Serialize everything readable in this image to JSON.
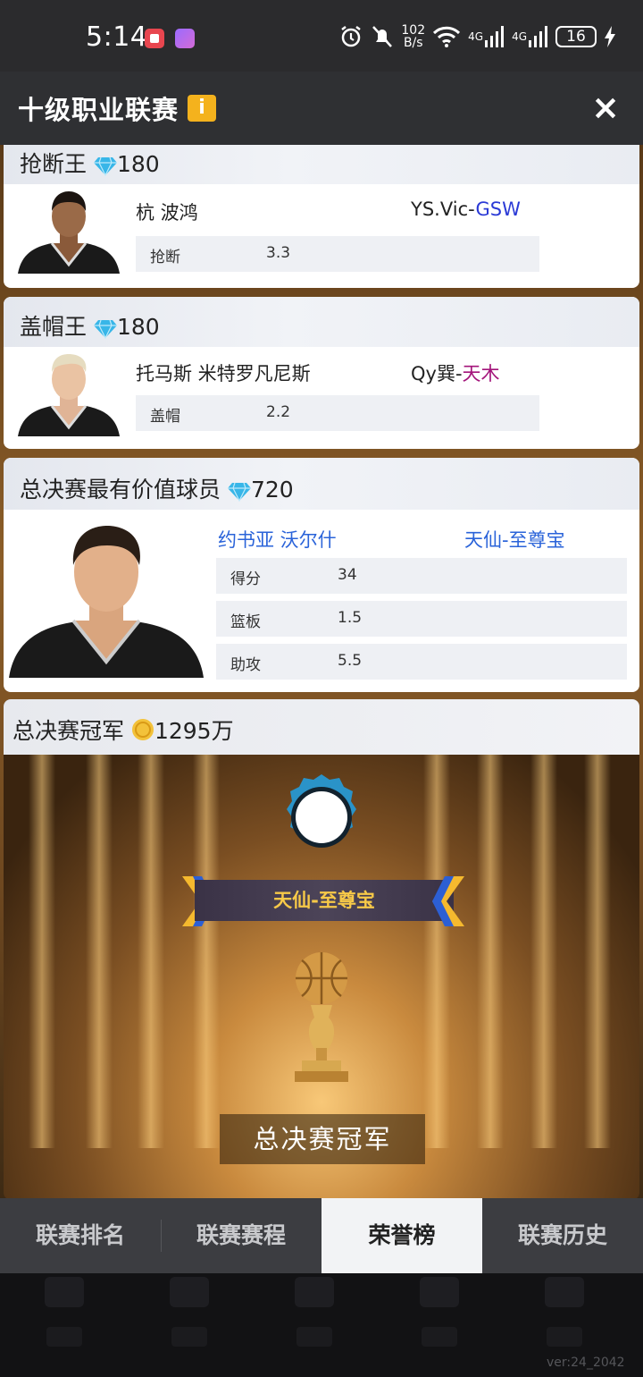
{
  "status_bar": {
    "time": "5:14",
    "net_speed_value": "102",
    "net_speed_unit": "B/s",
    "signal1": "4G",
    "signal2": "4G",
    "battery": "16"
  },
  "header": {
    "title": "十级职业联赛",
    "info_icon": "i",
    "close_icon": "×"
  },
  "steals_card": {
    "title": "抢断王",
    "reward": "180",
    "player_name": "杭 波鸿",
    "team_prefix": "YS.Vic-",
    "team_suffix": "GSW",
    "team_suffix_color": "#2b3ad6",
    "stat_label": "抢断",
    "stat_value": "3.3"
  },
  "blocks_card": {
    "title": "盖帽王",
    "reward": "180",
    "player_name": "托马斯 米特罗凡尼斯",
    "team_prefix": "Qy巽-",
    "team_suffix": "天木",
    "team_suffix_color": "#a3147a",
    "stat_label": "盖帽",
    "stat_value": "2.2"
  },
  "mvp_card": {
    "title": "总决赛最有价值球员",
    "reward": "720",
    "player_name": "约书亚 沃尔什",
    "team": "天仙-至尊宝",
    "name_color": "#2a63d9",
    "stats": [
      {
        "label": "得分",
        "value": "34"
      },
      {
        "label": "篮板",
        "value": "1.5"
      },
      {
        "label": "助攻",
        "value": "5.5"
      }
    ]
  },
  "champion_card": {
    "title": "总决赛冠军",
    "reward": "1295万",
    "team": "天仙-至尊宝",
    "caption": "总决赛冠军"
  },
  "tabs": [
    {
      "label": "联赛排名",
      "active": false
    },
    {
      "label": "联赛赛程",
      "active": false
    },
    {
      "label": "荣誉榜",
      "active": true
    },
    {
      "label": "联赛历史",
      "active": false
    }
  ],
  "footer": {
    "version": "ver:24_2042"
  },
  "colors": {
    "accent_gold": "#f4b21d",
    "diamond": "#38b6e8"
  }
}
